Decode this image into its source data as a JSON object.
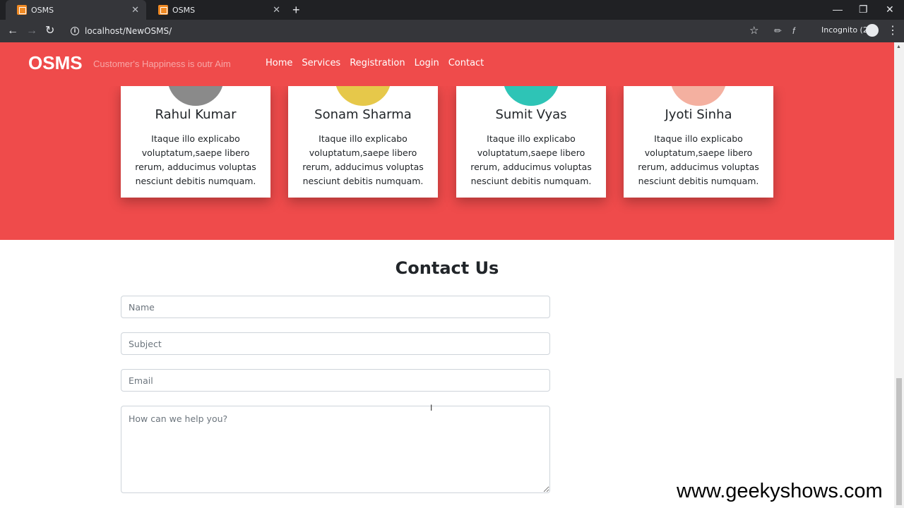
{
  "browser": {
    "tabs": [
      {
        "title": "OSMS",
        "close": "✕"
      },
      {
        "title": "OSMS",
        "close": "✕"
      }
    ],
    "new_tab": "+",
    "url": "localhost/NewOSMS/",
    "incognito_label": "Incognito (2)"
  },
  "site": {
    "brand": "OSMS",
    "tagline": "Customer's Happiness is outr Aim",
    "nav": [
      "Home",
      "Services",
      "Registration",
      "Login",
      "Contact"
    ]
  },
  "customers": [
    {
      "name": "Rahul Kumar",
      "text": "Itaque illo explicabo voluptatum,saepe libero rerum, adducimus voluptas nesciunt debitis numquam.",
      "avatar_color": "#8a8a8a"
    },
    {
      "name": "Sonam Sharma",
      "text": "Itaque illo explicabo voluptatum,saepe libero rerum, adducimus voluptas nesciunt debitis numquam.",
      "avatar_color": "#e6c84a"
    },
    {
      "name": "Sumit Vyas",
      "text": "Itaque illo explicabo voluptatum,saepe libero rerum, adducimus voluptas nesciunt debitis numquam.",
      "avatar_color": "#2ec4b6"
    },
    {
      "name": "Jyoti Sinha",
      "text": "Itaque illo explicabo voluptatum,saepe libero rerum, adducimus voluptas nesciunt debitis numquam.",
      "avatar_color": "#f4b0a0"
    }
  ],
  "contact": {
    "title": "Contact Us",
    "name_placeholder": "Name",
    "subject_placeholder": "Subject",
    "email_placeholder": "Email",
    "message_placeholder": "How can we help you?"
  },
  "watermark": "www.geekyshows.com",
  "colors": {
    "brand_red": "#ef4b4b",
    "chrome_dark": "#202124"
  }
}
